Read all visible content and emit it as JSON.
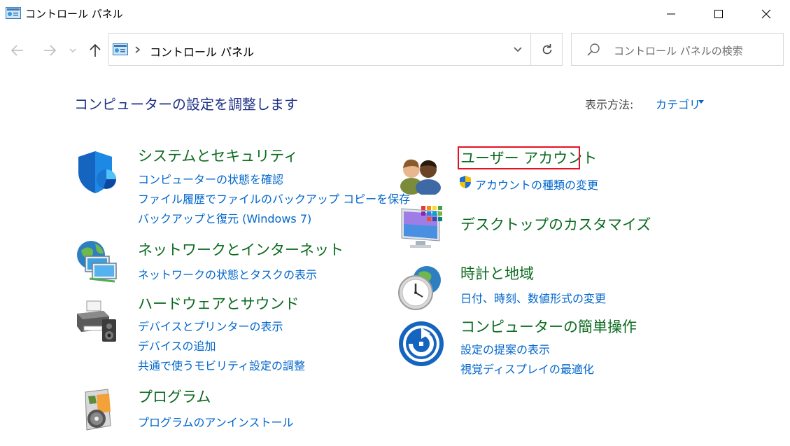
{
  "window": {
    "title": "コントロール パネル",
    "minimize_icon": "minimize-icon",
    "maximize_icon": "maximize-icon",
    "close_icon": "close-icon"
  },
  "navigation": {
    "back_icon": "arrow-left-icon",
    "forward_icon": "arrow-right-icon",
    "recent_icon": "chevron-down-icon",
    "up_icon": "arrow-up-icon"
  },
  "address_bar": {
    "path": "コントロール パネル",
    "dropdown_icon": "chevron-down-icon",
    "refresh_icon": "refresh-icon"
  },
  "search": {
    "placeholder": "コントロール パネルの検索",
    "icon": "search-icon"
  },
  "header": {
    "title": "コンピューターの設定を調整します",
    "view_by_label": "表示方法:",
    "view_by_value": "カテゴリ"
  },
  "left_categories": [
    {
      "title": "システムとセキュリティ",
      "icon": "shield-security-icon",
      "links": [
        "コンピューターの状態を確認",
        "ファイル履歴でファイルのバックアップ コピーを保存",
        "バックアップと復元 (Windows 7)"
      ]
    },
    {
      "title": "ネットワークとインターネット",
      "icon": "network-globe-icon",
      "links": [
        "ネットワークの状態とタスクの表示"
      ]
    },
    {
      "title": "ハードウェアとサウンド",
      "icon": "printer-speaker-icon",
      "links": [
        "デバイスとプリンターの表示",
        "デバイスの追加",
        "共通で使うモビリティ設定の調整"
      ]
    },
    {
      "title": "プログラム",
      "icon": "programs-disc-icon",
      "links": [
        "プログラムのアンインストール"
      ]
    }
  ],
  "right_categories": [
    {
      "title": "ユーザー アカウント",
      "icon": "users-icon",
      "links": [
        "アカウントの種類の変更"
      ],
      "link_icon": "uac-shield-icon"
    },
    {
      "title": "デスクトップのカスタマイズ",
      "icon": "desktop-monitor-icon",
      "links": []
    },
    {
      "title": "時計と地域",
      "icon": "clock-globe-icon",
      "links": [
        "日付、時刻、数値形式の変更"
      ]
    },
    {
      "title": "コンピューターの簡単操作",
      "icon": "ease-of-access-icon",
      "links": [
        "設定の提案の表示",
        "視覚ディスプレイの最適化"
      ]
    }
  ],
  "colors": {
    "title_blue": "#1e3287",
    "category_green": "#0c6b1f",
    "link_blue": "#0066cc",
    "highlight_red": "#e81123"
  }
}
